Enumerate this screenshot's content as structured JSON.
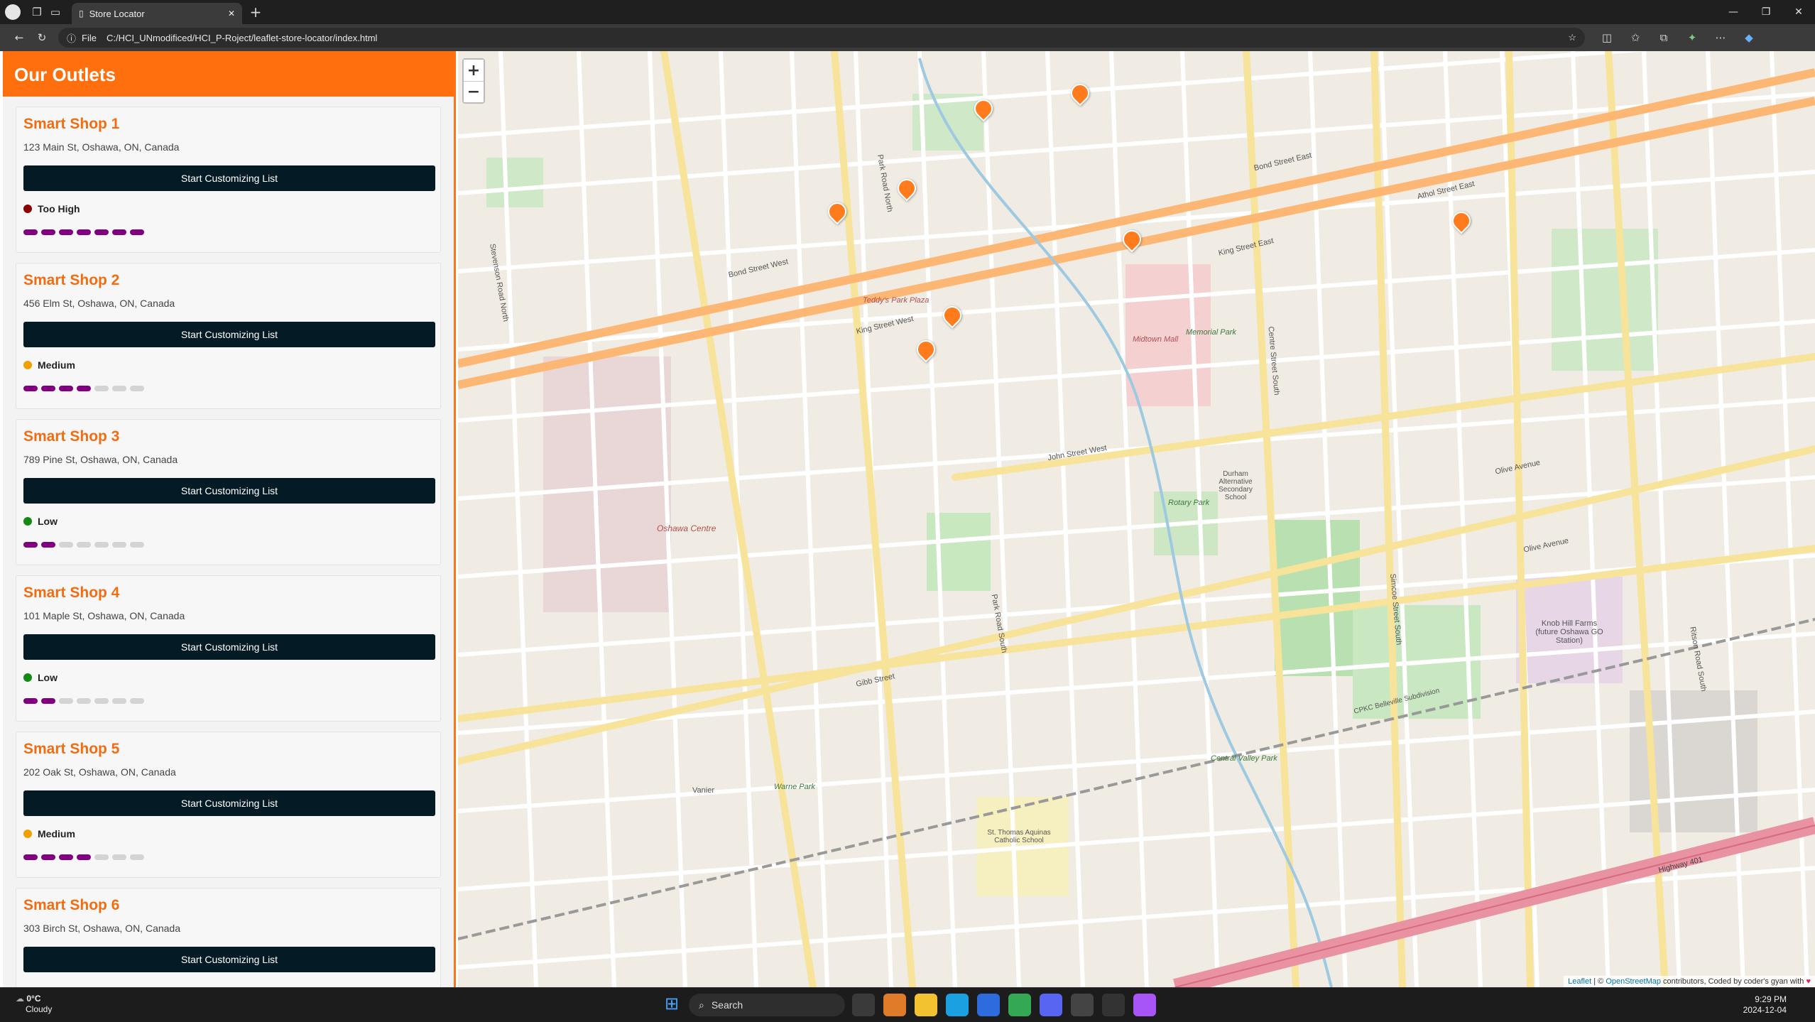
{
  "browser": {
    "tab_title": "Store Locator",
    "tab_close": "✕",
    "new_tab": "+",
    "file_label": "File",
    "url": "C:/HCI_UNmodificed/HCI_P-Roject/leaflet-store-locator/index.html"
  },
  "sidebar": {
    "title": "Our Outlets",
    "shops": [
      {
        "name": "Smart Shop 1",
        "address": "123 Main St, Oshawa, ON, Canada",
        "button": "Start Customizing List",
        "crowd_label": "Too High",
        "crowd_color": "#8b0000",
        "crowd_level": 7
      },
      {
        "name": "Smart Shop 2",
        "address": "456 Elm St, Oshawa, ON, Canada",
        "button": "Start Customizing List",
        "crowd_label": "Medium",
        "crowd_color": "#f0a000",
        "crowd_level": 4
      },
      {
        "name": "Smart Shop 3",
        "address": "789 Pine St, Oshawa, ON, Canada",
        "button": "Start Customizing List",
        "crowd_label": "Low",
        "crowd_color": "#138a13",
        "crowd_level": 2
      },
      {
        "name": "Smart Shop 4",
        "address": "101 Maple St, Oshawa, ON, Canada",
        "button": "Start Customizing List",
        "crowd_label": "Low",
        "crowd_color": "#138a13",
        "crowd_level": 2
      },
      {
        "name": "Smart Shop 5",
        "address": "202 Oak St, Oshawa, ON, Canada",
        "button": "Start Customizing List",
        "crowd_label": "Medium",
        "crowd_color": "#f0a000",
        "crowd_level": 4
      },
      {
        "name": "Smart Shop 6",
        "address": "303 Birch St, Oshawa, ON, Canada",
        "button": "Start Customizing List",
        "crowd_label": "",
        "crowd_color": "#888888",
        "crowd_level": 0
      }
    ]
  },
  "map": {
    "zoom_in": "+",
    "zoom_out": "−",
    "attribution_leaflet": "Leaflet",
    "attribution_osm": "OpenStreetMap",
    "attribution_rest": "contributors, Coded by coder's gyan with",
    "labels": {
      "bond_w": "Bond Street West",
      "bond_e": "Bond Street East",
      "king_w": "King Street West",
      "king_e": "King Street East",
      "athol": "Athol Street East",
      "john": "John Street West",
      "gibb": "Gibb Street",
      "olive": "Olive Avenue",
      "park_s": "Park Road South",
      "park_n": "Park Road North",
      "simcoe": "Simcoe Street South",
      "centre": "Centre Street South",
      "ritson": "Ritson Road South",
      "stevenson": "Stevenson Road North",
      "oshawa_centre": "Oshawa Centre",
      "teddy": "Teddy's Park Plaza",
      "midtown": "Midtown Mall",
      "memorial": "Memorial Park",
      "rotary": "Rotary Park",
      "central_valley": "Central Valley Park",
      "knob_hill": "Knob Hill Farms (future Oshawa GO Station)",
      "hwy401": "Highway 401",
      "durham": "Durham Alternative Secondary School",
      "st_thomas": "St. Thomas Aquinas Catholic School",
      "warne": "Warne Park",
      "vanier": "Vanier",
      "cpkc": "CPKC Belleville Subdivision"
    }
  },
  "taskbar": {
    "temp": "0°C",
    "weather": "Cloudy",
    "search": "Search",
    "time": "9:29 PM",
    "date": "2024-12-04"
  }
}
